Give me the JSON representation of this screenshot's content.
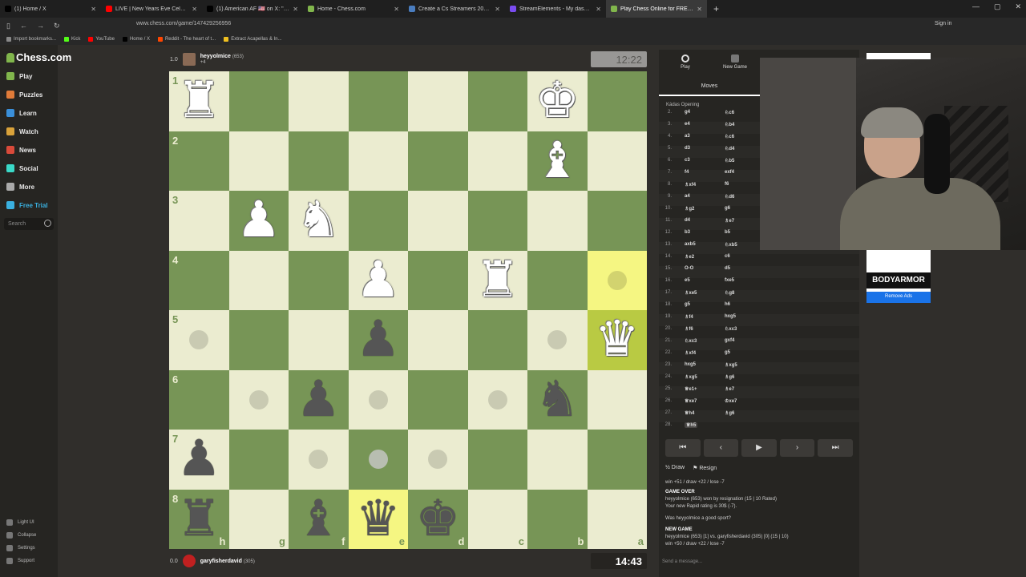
{
  "browser": {
    "tabs": [
      {
        "label": "(1) Home / X",
        "color": "#000000"
      },
      {
        "label": "LIVE | New Years Eve Celebratio",
        "color": "#ff0000"
      },
      {
        "label": "(1) American AF 🇺🇸 on X: \"A m",
        "color": "#000000"
      },
      {
        "label": "Home - Chess.com",
        "color": "#81b64c"
      },
      {
        "label": "Create a Cs Streamers 2025 Tie",
        "color": "#4a7dbf"
      },
      {
        "label": "StreamElements - My dashboa",
        "color": "#7a4cf0"
      },
      {
        "label": "Play Chess Online for FREE - 2",
        "color": "#81b64c"
      }
    ],
    "new_tab": "+",
    "url": "www.chess.com/game/147429256956",
    "sign_in": "Sign in",
    "bookmarks": [
      {
        "label": "Import bookmarks...",
        "color": "#888888"
      },
      {
        "label": "Kick",
        "color": "#53fc18"
      },
      {
        "label": "YouTube",
        "color": "#ff0000"
      },
      {
        "label": "Home / X",
        "color": "#000000"
      },
      {
        "label": "Reddit - The heart of t...",
        "color": "#ff4500"
      },
      {
        "label": "Extract Acapellas & In...",
        "color": "#f0c020"
      }
    ]
  },
  "sidebar": {
    "logo": "Chess.com",
    "items": [
      {
        "label": "Play",
        "icon": "play-icon",
        "color": "#81b64c"
      },
      {
        "label": "Puzzles",
        "icon": "puzzle-icon",
        "color": "#e07b39"
      },
      {
        "label": "Learn",
        "icon": "learn-icon",
        "color": "#3a8fd9"
      },
      {
        "label": "Watch",
        "icon": "watch-icon",
        "color": "#d9a23a"
      },
      {
        "label": "News",
        "icon": "news-icon",
        "color": "#d94a3a"
      },
      {
        "label": "Social",
        "icon": "social-icon",
        "color": "#3ad9c8"
      },
      {
        "label": "More",
        "icon": "more-icon",
        "color": "#aaaaaa"
      },
      {
        "label": "Free Trial",
        "icon": "diamond-icon",
        "color": "#3ab0e0"
      }
    ],
    "search_placeholder": "Search",
    "footer": [
      "Light UI",
      "Collapse",
      "Settings",
      "Support"
    ]
  },
  "game": {
    "top_player": {
      "score": "1.0",
      "name": "heyyolmice",
      "rating": "(653)",
      "sub": "+4"
    },
    "bottom_player": {
      "score": "0.0",
      "name": "garyfisherdavid",
      "rating": "(305)"
    },
    "top_clock": "12:22",
    "bottom_clock": "14:43",
    "ranks": [
      "1",
      "2",
      "3",
      "4",
      "5",
      "6",
      "7",
      "8"
    ],
    "files": [
      "h",
      "g",
      "f",
      "e",
      "d",
      "c",
      "b",
      "a"
    ],
    "pieces": [
      {
        "sq": "b1",
        "glyph": "♚",
        "color": "w"
      },
      {
        "sq": "h1",
        "glyph": "♜",
        "color": "w"
      },
      {
        "sq": "b2",
        "glyph": "♝",
        "color": "w"
      },
      {
        "sq": "f3",
        "glyph": "♞",
        "color": "w"
      },
      {
        "sq": "g3",
        "glyph": "♟",
        "color": "w"
      },
      {
        "sq": "c4",
        "glyph": "♜",
        "color": "w"
      },
      {
        "sq": "e4",
        "glyph": "♟",
        "color": "w"
      },
      {
        "sq": "a5",
        "glyph": "♛",
        "color": "w"
      },
      {
        "sq": "e5",
        "glyph": "♟",
        "color": "b"
      },
      {
        "sq": "b6",
        "glyph": "♞",
        "color": "b"
      },
      {
        "sq": "f6",
        "glyph": "♟",
        "color": "b"
      },
      {
        "sq": "h7",
        "glyph": "♟",
        "color": "b"
      },
      {
        "sq": "d8",
        "glyph": "♚",
        "color": "b"
      },
      {
        "sq": "e8",
        "glyph": "♛",
        "color": "b"
      },
      {
        "sq": "f8",
        "glyph": "♝",
        "color": "b"
      },
      {
        "sq": "h8",
        "glyph": "♜",
        "color": "b"
      }
    ],
    "highlights": [
      "a4",
      "a5",
      "e8"
    ],
    "dots": [
      "a4",
      "b5",
      "h5",
      "c6",
      "e6",
      "g6",
      "d7",
      "f7"
    ],
    "grey_dots": [
      "e7"
    ]
  },
  "panel": {
    "tabs": [
      {
        "label": "Play",
        "icon": "clock-icon"
      },
      {
        "label": "New Game",
        "icon": "plus-icon"
      }
    ],
    "moves_tab": "Moves",
    "opening": "Kádas Opening",
    "moves": [
      {
        "n": "2.",
        "w": "g4",
        "b": "♘c6"
      },
      {
        "n": "3.",
        "w": "e4",
        "b": "♘b4"
      },
      {
        "n": "4.",
        "w": "a3",
        "b": "♘c6"
      },
      {
        "n": "5.",
        "w": "d3",
        "b": "♘d4"
      },
      {
        "n": "6.",
        "w": "c3",
        "b": "♘b5"
      },
      {
        "n": "7.",
        "w": "f4",
        "b": "exf4"
      },
      {
        "n": "8.",
        "w": "♗xf4",
        "b": "f6"
      },
      {
        "n": "9.",
        "w": "a4",
        "b": "♘d6"
      },
      {
        "n": "10.",
        "w": "♗g2",
        "b": "g6"
      },
      {
        "n": "11.",
        "w": "d4",
        "b": "♗e7"
      },
      {
        "n": "12.",
        "w": "b3",
        "b": "b5"
      },
      {
        "n": "13.",
        "w": "axb5",
        "b": "♘xb5"
      },
      {
        "n": "14.",
        "w": "♗e2",
        "b": "c6"
      },
      {
        "n": "15.",
        "w": "O-O",
        "b": "d5"
      },
      {
        "n": "16.",
        "w": "e5",
        "b": "fxe5"
      },
      {
        "n": "17.",
        "w": "♗xe5",
        "b": "♘g8"
      },
      {
        "n": "18.",
        "w": "g5",
        "b": "h6"
      },
      {
        "n": "19.",
        "w": "♗f4",
        "b": "hxg5"
      },
      {
        "n": "20.",
        "w": "♗f6",
        "b": "♘xc3"
      },
      {
        "n": "21.",
        "w": "♘xc3",
        "b": "gxf4"
      },
      {
        "n": "22.",
        "w": "♗xf4",
        "b": "g5"
      },
      {
        "n": "23.",
        "w": "hxg5",
        "b": "♗xg5"
      },
      {
        "n": "24.",
        "w": "♗xg5",
        "b": "♗g6"
      },
      {
        "n": "25.",
        "w": "♕e1+",
        "b": "♗e7"
      },
      {
        "n": "26.",
        "w": "♕xe7",
        "b": "♔xe7"
      },
      {
        "n": "27.",
        "w": "♕h4",
        "b": "♗g6"
      },
      {
        "n": "28.",
        "w": "♕h5",
        "b": ""
      }
    ],
    "controls": [
      "⏮",
      "‹",
      "▶",
      "›",
      "⏭"
    ],
    "draw": "½ Draw",
    "resign": "⚑ Resign",
    "stats1": "win +51 / draw +22 / lose -7",
    "game_over": "GAME OVER",
    "result": "heyyolmice (653) won by resignation (15 | 10 Rated)",
    "rating_change": "Your new Rapid rating is 30$ (-7).",
    "good_sport": "Was heyyolmice a good sport?",
    "new_game": "NEW GAME",
    "matchup": "heyyolmice (653) [1] vs. garyfisherdavid (305) [0] (15 | 10)",
    "stats2": "win +50 / draw +22 / lose -7",
    "message_placeholder": "Send a message..."
  },
  "ad": {
    "brand": "BODYARMOR",
    "remove": "Remove Ads"
  }
}
